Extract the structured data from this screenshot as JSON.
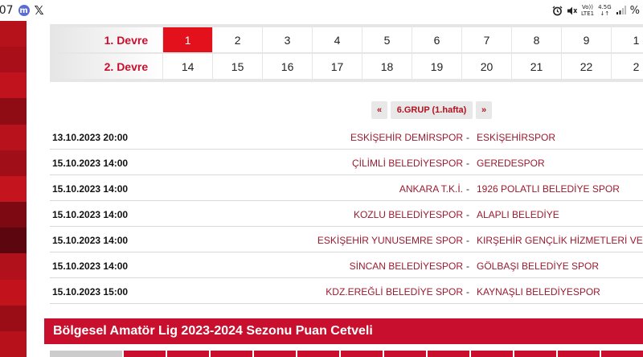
{
  "status_bar": {
    "time": ":07",
    "app_icon_letter": "m",
    "x_icon": "𝕏",
    "net_label_top": "Vo))",
    "net_label_bottom": "LTE1",
    "gen_label_top": "4.5G",
    "gen_label_bottom": "↓↑",
    "battery_text": "%"
  },
  "rounds": {
    "first": {
      "label": "1. Devre",
      "numbers": [
        "1",
        "2",
        "3",
        "4",
        "5",
        "6",
        "7",
        "8",
        "9",
        "1"
      ],
      "active": "1"
    },
    "second": {
      "label": "2. Devre",
      "numbers": [
        "14",
        "15",
        "16",
        "17",
        "18",
        "19",
        "20",
        "21",
        "22",
        "2"
      ]
    }
  },
  "group_nav": {
    "prev": "«",
    "title": "6.GRUP (1.hafta)",
    "next": "»"
  },
  "matches": [
    {
      "date": "13.10.2023 20:00",
      "home": "ESKİŞEHİR DEMİRSPOR",
      "sep": "-",
      "away": "ESKİŞEHİRSPOR"
    },
    {
      "date": "15.10.2023 14:00",
      "home": "ÇİLİMLİ BELEDİYESPOR",
      "sep": "-",
      "away": "GEREDESPOR"
    },
    {
      "date": "15.10.2023 14:00",
      "home": "ANKARA T.K.İ.",
      "sep": "-",
      "away": "1926 POLATLI BELEDİYE SPOR"
    },
    {
      "date": "15.10.2023 14:00",
      "home": "KOZLU BELEDİYESPOR",
      "sep": "-",
      "away": "ALAPLI BELEDİYE"
    },
    {
      "date": "15.10.2023 14:00",
      "home": "ESKİŞEHİR YUNUSEMRE SPOR",
      "sep": "-",
      "away": "KIRŞEHİR GENÇLİK HİZMETLERİ VE SPOR"
    },
    {
      "date": "15.10.2023 14:00",
      "home": "SİNCAN BELEDİYESPOR",
      "sep": "-",
      "away": "GÖLBAŞI BELEDİYE SPOR"
    },
    {
      "date": "15.10.2023 15:00",
      "home": "KDZ.EREĞLİ BELEDİYE SPOR",
      "sep": "-",
      "away": "KAYNAŞLI BELEDİYESPOR"
    }
  ],
  "standings": {
    "title": "Bölgesel Amatör Lig 2023-2024 Sezonu Puan Cetveli"
  },
  "colors": {
    "accent_red": "#e3111b",
    "team_red": "#9a1b2e",
    "strip": [
      "#b5121b",
      "#a90f18",
      "#c0131d",
      "#8f0c15",
      "#b8121c",
      "#a00e17",
      "#c4141e",
      "#7d0a12",
      "#5c0710",
      "#b0111a",
      "#c2131d",
      "#9a0d16",
      "#b7121c"
    ]
  }
}
